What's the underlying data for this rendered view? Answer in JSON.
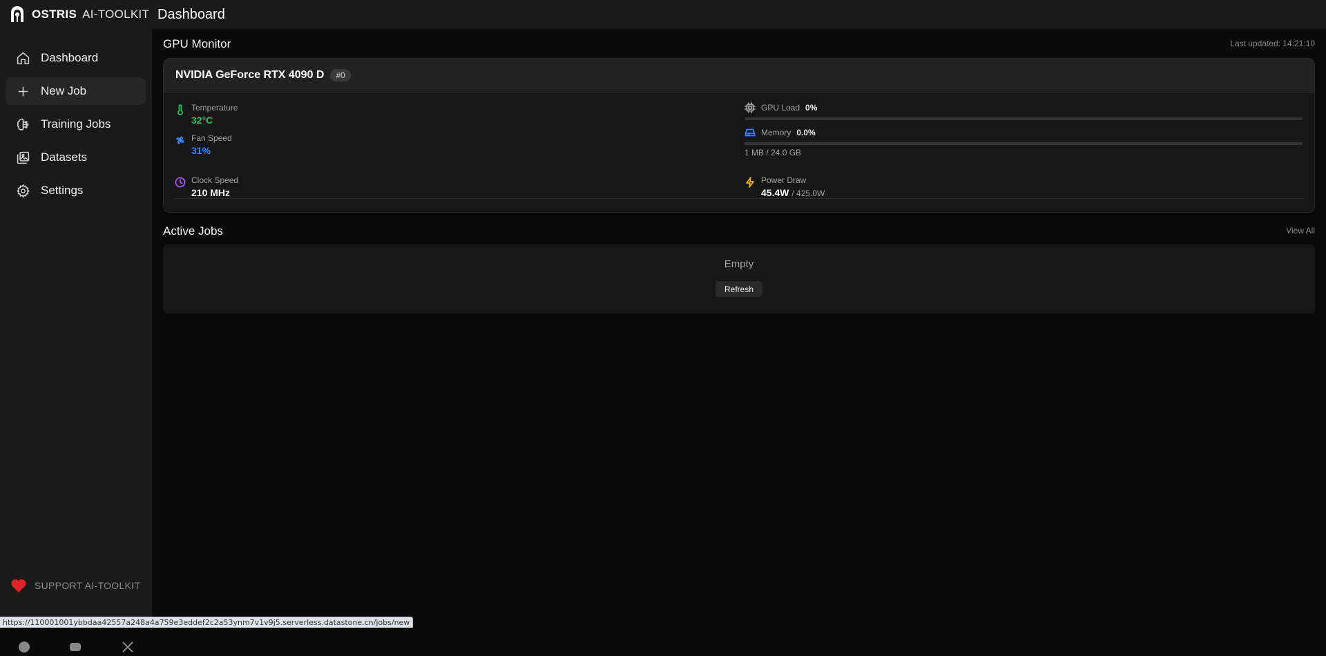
{
  "app": {
    "brand": "OSTRIS",
    "brand_suffix": "AI-TOOLKIT",
    "page_title": "Dashboard"
  },
  "sidebar": {
    "items": [
      {
        "label": "Dashboard",
        "icon": "home-icon"
      },
      {
        "label": "New Job",
        "icon": "plus-icon",
        "active": true
      },
      {
        "label": "Training Jobs",
        "icon": "brain-icon"
      },
      {
        "label": "Datasets",
        "icon": "images-icon"
      },
      {
        "label": "Settings",
        "icon": "gear-icon"
      }
    ],
    "support_label": "SUPPORT AI-TOOLKIT"
  },
  "gpu_monitor": {
    "title": "GPU Monitor",
    "last_updated": "Last updated: 14:21:10",
    "gpu_name": "NVIDIA GeForce RTX 4090 D",
    "gpu_index": "#0",
    "temperature_label": "Temperature",
    "temperature_value": "32°C",
    "fan_label": "Fan Speed",
    "fan_value": "31%",
    "clock_label": "Clock Speed",
    "clock_value": "210 MHz",
    "gpu_load_label": "GPU Load",
    "gpu_load_value": "0%",
    "gpu_load_fraction": 0,
    "memory_label": "Memory",
    "memory_value": "0.0%",
    "memory_fraction": 0,
    "memory_detail": "1 MB / 24.0 GB",
    "power_label": "Power Draw",
    "power_value": "45.4W",
    "power_limit": "/ 425.0W"
  },
  "active_jobs": {
    "title": "Active Jobs",
    "view_all": "View All",
    "empty_text": "Empty",
    "refresh_label": "Refresh"
  },
  "status_url": "https://110001001ybbdaa42557a248a4a759e3eddef2c2a53ynm7v1v9j5.serverless.datastone.cn/jobs/new",
  "colors": {
    "accent_green": "#22c55e",
    "accent_blue": "#3b82f6",
    "heart_red": "#dc2626",
    "sidebar_bg": "#1a1a1a",
    "main_bg": "#0a0a0a"
  }
}
